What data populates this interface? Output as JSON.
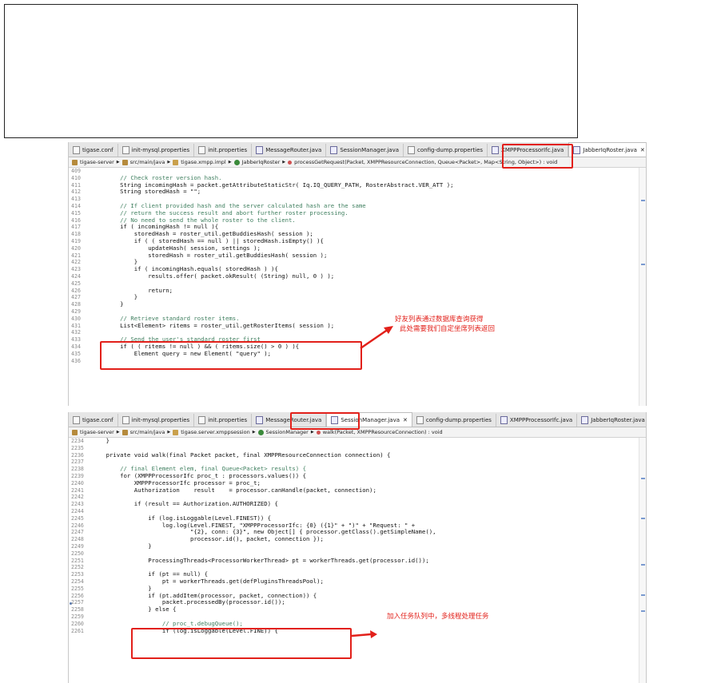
{
  "panel1": {
    "tabs": [
      {
        "label": "tigase.conf",
        "type": "file"
      },
      {
        "label": "init-mysql.properties",
        "type": "file"
      },
      {
        "label": "init.properties",
        "type": "file"
      },
      {
        "label": "MessageRouter.java",
        "type": "java"
      },
      {
        "label": "SessionManager.java",
        "type": "java"
      },
      {
        "label": "config-dump.properties",
        "type": "file"
      },
      {
        "label": "XMPPProcessorIfc.java",
        "type": "java"
      },
      {
        "label": "JabberIqRoster.java",
        "type": "java",
        "active": true
      }
    ],
    "close_glyph": "✕",
    "window_controls": [
      "▭",
      "□"
    ],
    "breadcrumb": [
      "tigase-server",
      "src/main/java",
      "tigase.xmpp.impl",
      "JabberIqRoster",
      "processGetRequest(Packet, XMPPResourceConnection, Queue<Packet>, Map<String, Object>) : void"
    ],
    "lines": [
      {
        "n": "409",
        "t": ""
      },
      {
        "n": "410",
        "t": "        // Check roster version hash.",
        "c": true
      },
      {
        "n": "411",
        "t": "        String incomingHash = packet.getAttributeStaticStr( Iq.IQ_QUERY_PATH, RosterAbstract.VER_ATT );"
      },
      {
        "n": "412",
        "t": "        String storedHash = \"\";"
      },
      {
        "n": "413",
        "t": ""
      },
      {
        "n": "414",
        "t": "        // If client provided hash and the server calculated hash are the same",
        "c": true
      },
      {
        "n": "415",
        "t": "        // return the success result and abort further roster processing.",
        "c": true
      },
      {
        "n": "416",
        "t": "        // No need to send the whole roster to the client.",
        "c": true
      },
      {
        "n": "417",
        "t": "        if ( incomingHash != null ){"
      },
      {
        "n": "418",
        "t": "            storedHash = roster_util.getBuddiesHash( session );"
      },
      {
        "n": "419",
        "t": "            if ( ( storedHash == null ) || storedHash.isEmpty() ){"
      },
      {
        "n": "420",
        "t": "                updateHash( session, settings );"
      },
      {
        "n": "421",
        "t": "                storedHash = roster_util.getBuddiesHash( session );"
      },
      {
        "n": "422",
        "t": "            }"
      },
      {
        "n": "423",
        "t": "            if ( incomingHash.equals( storedHash ) ){"
      },
      {
        "n": "424",
        "t": "                results.offer( packet.okResult( (String) null, 0 ) );"
      },
      {
        "n": "425",
        "t": ""
      },
      {
        "n": "426",
        "t": "                return;"
      },
      {
        "n": "427",
        "t": "            }"
      },
      {
        "n": "428",
        "t": "        }"
      },
      {
        "n": "429",
        "t": ""
      },
      {
        "n": "430",
        "t": "        // Retrieve standard roster items.",
        "c": true
      },
      {
        "n": "431",
        "t": "        List<Element> ritems = roster_util.getRosterItems( session );"
      },
      {
        "n": "432",
        "t": ""
      },
      {
        "n": "433",
        "t": "        // Send the user's standard roster first",
        "c": true
      },
      {
        "n": "434",
        "t": "        if ( ( ritems != null ) && ( ritems.size() > 0 ) ){"
      },
      {
        "n": "435",
        "t": "            Element query = new Element( \"query\" );"
      },
      {
        "n": "436",
        "t": ""
      }
    ],
    "annotation": [
      "好友列表通过数据库查询获得",
      "此处需要我们自定坐席列表返回"
    ]
  },
  "panel2": {
    "tabs": [
      {
        "label": "tigase.conf",
        "type": "file"
      },
      {
        "label": "init-mysql.properties",
        "type": "file"
      },
      {
        "label": "init.properties",
        "type": "file"
      },
      {
        "label": "MessageRouter.java",
        "type": "java"
      },
      {
        "label": "SessionManager.java",
        "type": "java",
        "active": true
      },
      {
        "label": "config-dump.properties",
        "type": "file"
      },
      {
        "label": "XMPPProcessorIfc.java",
        "type": "java"
      },
      {
        "label": "JabberIqRoster.java",
        "type": "java"
      }
    ],
    "close_glyph": "✕",
    "window_controls": [
      "▭",
      "□"
    ],
    "breadcrumb": [
      "tigase-server",
      "src/main/java",
      "tigase.server.xmppsession",
      "SessionManager",
      "walk(Packet, XMPPResourceConnection) : void"
    ],
    "lines": [
      {
        "n": "2234",
        "t": "    }"
      },
      {
        "n": "2235",
        "t": ""
      },
      {
        "n": "2236",
        "t": "    private void walk(final Packet packet, final XMPPResourceConnection connection) {"
      },
      {
        "n": "2237",
        "t": ""
      },
      {
        "n": "2238",
        "t": "        // final Element elem, final Queue<Packet> results) {",
        "c": true
      },
      {
        "n": "2239",
        "t": "        for (XMPPProcessorIfc proc_t : processors.values()) {"
      },
      {
        "n": "2240",
        "t": "            XMPPProcessorIfc processor = proc_t;"
      },
      {
        "n": "2241",
        "t": "            Authorization    result    = processor.canHandle(packet, connection);"
      },
      {
        "n": "2242",
        "t": ""
      },
      {
        "n": "2243",
        "t": "            if (result == Authorization.AUTHORIZED) {"
      },
      {
        "n": "2244",
        "t": ""
      },
      {
        "n": "2245",
        "t": "                if (log.isLoggable(Level.FINEST)) {"
      },
      {
        "n": "2246",
        "t": "                    log.log(Level.FINEST, \"XMPPProcessorIfc: {0} ({1}\" + \")\" + \"Request: \" +"
      },
      {
        "n": "2247",
        "t": "                            \"{2}, conn: {3}\", new Object[] { processor.getClass().getSimpleName(),"
      },
      {
        "n": "2248",
        "t": "                            processor.id(), packet, connection });"
      },
      {
        "n": "2249",
        "t": "                }"
      },
      {
        "n": "2250",
        "t": ""
      },
      {
        "n": "2251",
        "t": "                ProcessingThreads<ProcessorWorkerThread> pt = workerThreads.get(processor.id());"
      },
      {
        "n": "2252",
        "t": ""
      },
      {
        "n": "2253",
        "t": "                if (pt == null) {"
      },
      {
        "n": "2254",
        "t": "                    pt = workerThreads.get(defPluginsThreadsPool);"
      },
      {
        "n": "2255",
        "t": "                }"
      },
      {
        "n": "2256",
        "t": "                if (pt.addItem(processor, packet, connection)) {"
      },
      {
        "n": "2257",
        "t": "                    packet.processedBy(processor.id());"
      },
      {
        "n": "2258",
        "t": "                } else {"
      },
      {
        "n": "2259",
        "t": ""
      },
      {
        "n": "2260",
        "t": "                    // proc_t.debugQueue();",
        "c": true
      },
      {
        "n": "2261",
        "t": "                    if (log.isLoggable(Level.FINE)) {"
      }
    ],
    "annotation": [
      "加入任务队列中，多线程处理任务"
    ]
  }
}
